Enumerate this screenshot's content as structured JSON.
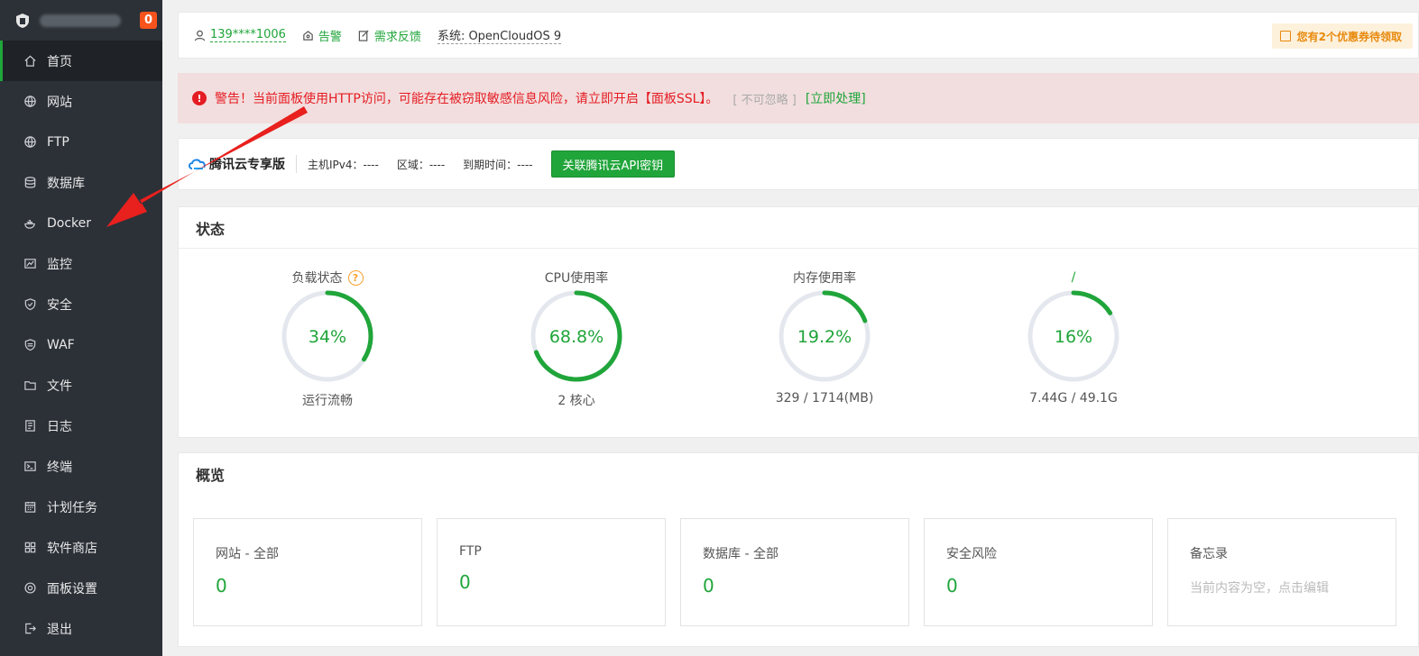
{
  "sidebar": {
    "badge": "0",
    "items": [
      {
        "label": "首页",
        "icon": "home-icon",
        "active": true
      },
      {
        "label": "网站",
        "icon": "globe-icon"
      },
      {
        "label": "FTP",
        "icon": "ftp-globe-icon"
      },
      {
        "label": "数据库",
        "icon": "database-icon"
      },
      {
        "label": "Docker",
        "icon": "docker-icon"
      },
      {
        "label": "监控",
        "icon": "monitor-chart-icon"
      },
      {
        "label": "安全",
        "icon": "shield-icon"
      },
      {
        "label": "WAF",
        "icon": "waf-shield-icon"
      },
      {
        "label": "文件",
        "icon": "folder-icon"
      },
      {
        "label": "日志",
        "icon": "log-icon"
      },
      {
        "label": "终端",
        "icon": "terminal-icon"
      },
      {
        "label": "计划任务",
        "icon": "calendar-icon"
      },
      {
        "label": "软件商店",
        "icon": "app-grid-icon"
      },
      {
        "label": "面板设置",
        "icon": "settings-icon"
      },
      {
        "label": "退出",
        "icon": "logout-icon"
      }
    ]
  },
  "topbar": {
    "user": "139****1006",
    "alert": "告警",
    "feedback": "需求反馈",
    "system": "系统: OpenCloudOS 9",
    "coupon": "您有2个优惠券待领取"
  },
  "warning": {
    "text": "警告！当前面板使用HTTP访问，可能存在被窃取敏感信息风险，请立即开启【面板SSL】。",
    "ignore": "[ 不可忽略 ]",
    "action": "[立即处理]"
  },
  "cloud": {
    "title": "腾讯云专享版",
    "ipv4": "主机IPv4：----",
    "region": "区域：----",
    "expire": "到期时间：----",
    "button": "关联腾讯云API密钥"
  },
  "status": {
    "title": "状态",
    "gauges": [
      {
        "label": "负载状态",
        "value_text": "34%",
        "percent": 34,
        "sub": "运行流畅",
        "help": "?"
      },
      {
        "label": "CPU使用率",
        "value_text": "68.8%",
        "percent": 68.8,
        "sub": "2 核心"
      },
      {
        "label": "内存使用率",
        "value_text": "19.2%",
        "percent": 19.2,
        "sub": "329 / 1714(MB)"
      },
      {
        "label": "/",
        "value_text": "16%",
        "percent": 16,
        "sub": "7.44G / 49.1G"
      }
    ]
  },
  "overview": {
    "title": "概览",
    "cards": [
      {
        "title": "网站 - 全部",
        "value": "0"
      },
      {
        "title": "FTP",
        "value": "0"
      },
      {
        "title": "数据库 - 全部",
        "value": "0"
      },
      {
        "title": "安全风险",
        "value": "0"
      },
      {
        "title": "备忘录",
        "hint": "当前内容为空，点击编辑"
      }
    ]
  },
  "colors": {
    "accent": "#20a53a",
    "danger": "#e51c23",
    "sidebar": "#2c3138",
    "arrow": "#e8201e"
  }
}
